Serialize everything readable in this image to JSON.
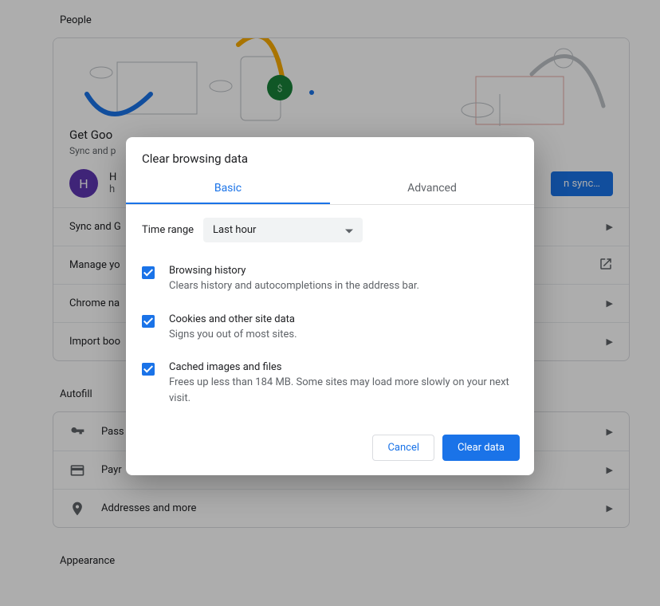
{
  "sections": {
    "people": {
      "title": "People",
      "headline": "Get Goo",
      "subline": "Sync and p",
      "avatar_initial": "H",
      "name_trunc": "H",
      "email_trunc": "h",
      "sync_button": "n sync…",
      "rows": [
        {
          "label": "Sync and G"
        },
        {
          "label": "Manage yo"
        },
        {
          "label": "Chrome na"
        },
        {
          "label": "Import boo"
        }
      ]
    },
    "autofill": {
      "title": "Autofill",
      "rows": [
        {
          "icon": "key-icon",
          "label": "Pass"
        },
        {
          "icon": "credit-card-icon",
          "label": "Payr"
        },
        {
          "icon": "location-pin-icon",
          "label": "Addresses and more"
        }
      ]
    },
    "appearance": {
      "title": "Appearance"
    }
  },
  "dialog": {
    "title": "Clear browsing data",
    "tabs": {
      "basic": "Basic",
      "advanced": "Advanced",
      "active": "basic"
    },
    "time_range": {
      "label": "Time range",
      "value": "Last hour"
    },
    "options": [
      {
        "checked": true,
        "title": "Browsing history",
        "desc": "Clears history and autocompletions in the address bar."
      },
      {
        "checked": true,
        "title": "Cookies and other site data",
        "desc": "Signs you out of most sites."
      },
      {
        "checked": true,
        "title": "Cached images and files",
        "desc": "Frees up less than 184 MB. Some sites may load more slowly on your next visit."
      }
    ],
    "actions": {
      "cancel": "Cancel",
      "confirm": "Clear data"
    }
  },
  "colors": {
    "primary": "#1a73e8"
  }
}
